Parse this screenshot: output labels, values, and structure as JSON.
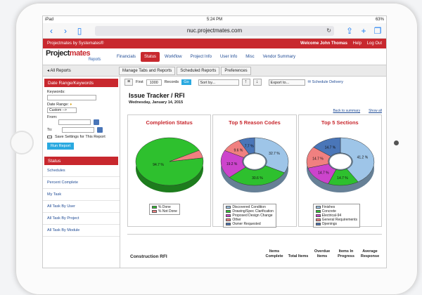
{
  "status_bar": {
    "carrier": "iPad",
    "time": "5:24 PM",
    "battery": "63%"
  },
  "browser": {
    "url": "nuc.projectmates.com"
  },
  "app_header": {
    "left": "Projectmates by Systemates®",
    "welcome": "Welcome John Thomas",
    "help": "Help",
    "logout": "Log Out"
  },
  "logo": {
    "part1": "Project",
    "part2": "mates",
    "sub": "Reports"
  },
  "nav_tabs": [
    "Financials",
    "Status",
    "Workflow",
    "Project Info",
    "User Info",
    "Misc",
    "Vendor Summary"
  ],
  "subnav": {
    "back": "All Reports",
    "tabs": [
      "Manage Tabs and Reports",
      "Scheduled Reports",
      "Preferences"
    ]
  },
  "sidebar": {
    "head": "Date Range/Keywords",
    "keywords_label": "Keywords:",
    "date_range_label": "Date Range:",
    "date_range_value": "Custom -->",
    "from_label": "From:",
    "to_label": "To:",
    "save_label": "Save Settings for This Report",
    "run_label": "Run Report",
    "status_head": "Status",
    "items": [
      "Schedules",
      "Percent Complete",
      "My Task",
      "All Task By User",
      "All Task By Project",
      "All Task By Module"
    ]
  },
  "toolbar": {
    "first_label": "First",
    "first_value": "1000",
    "records_label": "Records",
    "go_label": "Go",
    "sort_label": "Sort by...",
    "export_label": "Export to...",
    "schedule_label": "Schedule Delivery"
  },
  "report": {
    "title": "Issue Tracker / RFI",
    "date": "Wednesday, January 14, 2015",
    "back_link": "Back to summary",
    "show_all": "Show all"
  },
  "panels": [
    {
      "title": "Completion Status"
    },
    {
      "title": "Top 5 Reason Codes"
    },
    {
      "title": "Top 5 Sections"
    }
  ],
  "chart_data": [
    {
      "type": "pie",
      "title": "Completion Status",
      "categories": [
        "% Done",
        "% Not Done"
      ],
      "values": [
        94.7,
        5.3
      ],
      "colors": [
        "#2ec02e",
        "#f08080"
      ],
      "labels": [
        "94.7 %",
        ""
      ]
    },
    {
      "type": "pie",
      "title": "Top 5 Reason Codes",
      "categories": [
        "Discovered Condition",
        "Drawing/Spec Clarification",
        "Proposed Design Change",
        "Other",
        "Owner Requested"
      ],
      "values": [
        32.7,
        30.6,
        19.2,
        9.6,
        7.7
      ],
      "colors": [
        "#9ec5e8",
        "#2ec02e",
        "#cc44cc",
        "#f08080",
        "#4a76b8"
      ],
      "labels": [
        "32.7 %",
        "30.6 %",
        "19.2 %",
        "9.6 %",
        "7.7 %"
      ]
    },
    {
      "type": "pie",
      "title": "Top 5 Sections",
      "categories": [
        "Finishes",
        "Concrete",
        "Electrical-94",
        "General Requirements",
        "Openings"
      ],
      "values": [
        41.2,
        14.7,
        14.7,
        14.7,
        14.7
      ],
      "colors": [
        "#9ec5e8",
        "#2ec02e",
        "#cc44cc",
        "#f08080",
        "#4a76b8"
      ],
      "labels": [
        "41.2 %",
        "14.7 %",
        "14.7 %",
        "14.7 %",
        "14.7 %"
      ]
    }
  ],
  "table": {
    "caption": "Construction RFI",
    "columns": [
      "Items Complete",
      "Total Items",
      "Overdue Items",
      "Items In Progress",
      "Average Response"
    ]
  }
}
